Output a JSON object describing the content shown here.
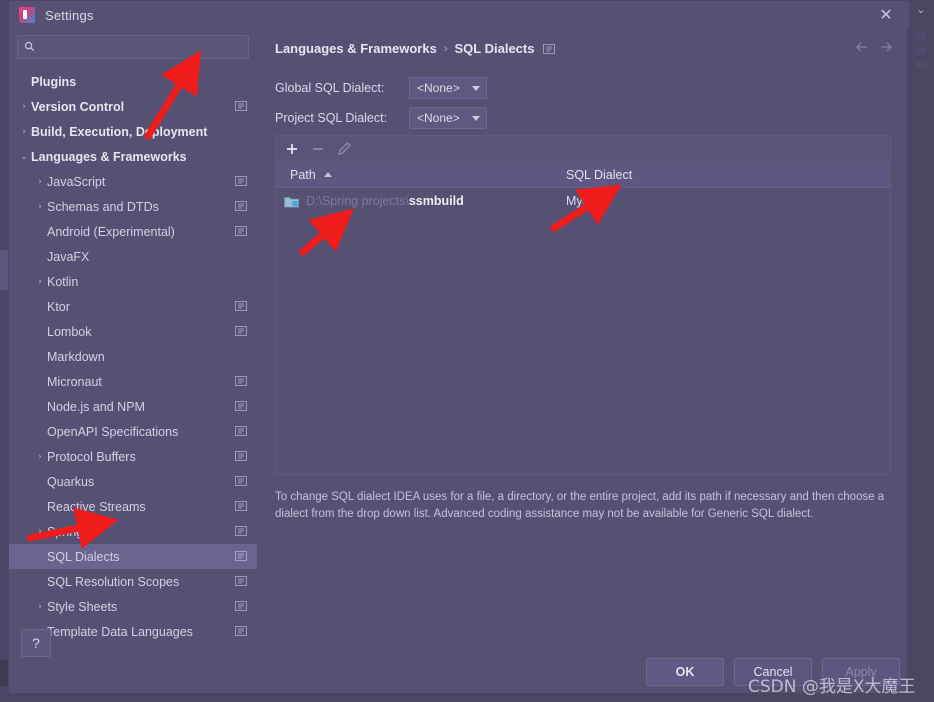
{
  "window": {
    "title": "Settings",
    "close_label": "✕",
    "app_icon": "intellij-idea-icon"
  },
  "sidebar": {
    "search": {
      "placeholder": "",
      "value": "",
      "icon": "search-icon"
    },
    "items": [
      {
        "label": "Plugins",
        "level": 1,
        "arrow": "",
        "bold": true,
        "badge": false,
        "selected": false
      },
      {
        "label": "Version Control",
        "level": 1,
        "arrow": "›",
        "bold": true,
        "badge": true,
        "selected": false
      },
      {
        "label": "Build, Execution, Deployment",
        "level": 1,
        "arrow": "›",
        "bold": true,
        "badge": false,
        "selected": false
      },
      {
        "label": "Languages & Frameworks",
        "level": 1,
        "arrow": "⌄",
        "bold": true,
        "badge": false,
        "selected": false
      },
      {
        "label": "JavaScript",
        "level": 2,
        "arrow": "›",
        "bold": false,
        "badge": true,
        "selected": false
      },
      {
        "label": "Schemas and DTDs",
        "level": 2,
        "arrow": "›",
        "bold": false,
        "badge": true,
        "selected": false
      },
      {
        "label": "Android (Experimental)",
        "level": 2,
        "arrow": "",
        "bold": false,
        "badge": true,
        "selected": false
      },
      {
        "label": "JavaFX",
        "level": 2,
        "arrow": "",
        "bold": false,
        "badge": false,
        "selected": false
      },
      {
        "label": "Kotlin",
        "level": 2,
        "arrow": "›",
        "bold": false,
        "badge": false,
        "selected": false
      },
      {
        "label": "Ktor",
        "level": 2,
        "arrow": "",
        "bold": false,
        "badge": true,
        "selected": false
      },
      {
        "label": "Lombok",
        "level": 2,
        "arrow": "",
        "bold": false,
        "badge": true,
        "selected": false
      },
      {
        "label": "Markdown",
        "level": 2,
        "arrow": "",
        "bold": false,
        "badge": false,
        "selected": false
      },
      {
        "label": "Micronaut",
        "level": 2,
        "arrow": "",
        "bold": false,
        "badge": true,
        "selected": false
      },
      {
        "label": "Node.js and NPM",
        "level": 2,
        "arrow": "",
        "bold": false,
        "badge": true,
        "selected": false
      },
      {
        "label": "OpenAPI Specifications",
        "level": 2,
        "arrow": "",
        "bold": false,
        "badge": true,
        "selected": false
      },
      {
        "label": "Protocol Buffers",
        "level": 2,
        "arrow": "›",
        "bold": false,
        "badge": true,
        "selected": false
      },
      {
        "label": "Quarkus",
        "level": 2,
        "arrow": "",
        "bold": false,
        "badge": true,
        "selected": false
      },
      {
        "label": "Reactive Streams",
        "level": 2,
        "arrow": "",
        "bold": false,
        "badge": true,
        "selected": false
      },
      {
        "label": "Spring",
        "level": 2,
        "arrow": "›",
        "bold": false,
        "badge": true,
        "selected": false
      },
      {
        "label": "SQL Dialects",
        "level": 2,
        "arrow": "",
        "bold": false,
        "badge": true,
        "selected": true
      },
      {
        "label": "SQL Resolution Scopes",
        "level": 2,
        "arrow": "",
        "bold": false,
        "badge": true,
        "selected": false
      },
      {
        "label": "Style Sheets",
        "level": 2,
        "arrow": "›",
        "bold": false,
        "badge": true,
        "selected": false
      },
      {
        "label": "Template Data Languages",
        "level": 2,
        "arrow": "",
        "bold": false,
        "badge": true,
        "selected": false
      }
    ],
    "help_label": "?"
  },
  "content": {
    "breadcrumb": {
      "parent": "Languages & Frameworks",
      "separator": "›",
      "current": "SQL Dialects"
    },
    "fields": [
      {
        "label": "Global SQL Dialect:",
        "value": "<None>"
      },
      {
        "label": "Project SQL Dialect:",
        "value": "<None>"
      }
    ],
    "toolbar": [
      {
        "name": "add-button",
        "glyph": "+",
        "disabled": false
      },
      {
        "name": "remove-button",
        "glyph": "−",
        "disabled": true
      },
      {
        "name": "edit-button",
        "glyph": "✎",
        "disabled": true
      }
    ],
    "table": {
      "columns": [
        "Path",
        "SQL Dialect"
      ],
      "sort_column": "Path",
      "sort_direction": "asc",
      "rows": [
        {
          "path_prefix": "D:\\Spring projects\\",
          "path_name": "ssmbuild",
          "dialect": "MySQL"
        }
      ]
    },
    "hint": "To change SQL dialect IDEA uses for a file, a directory, or the entire project, add its path if necessary and then choose a dialect from the drop down list. Advanced coding assistance may not be available for Generic SQL dialect."
  },
  "buttons": {
    "ok": "OK",
    "cancel": "Cancel",
    "apply": "Apply"
  },
  "watermark": "CSDN @我是X大魔王",
  "colors": {
    "window_bg": "#565073",
    "page_bg": "#4b4663",
    "selected_row": "#6a6490",
    "header_row": "#5d5781",
    "text": "#d4d1e0",
    "text_bright": "#e7e5ef",
    "text_dim": "#7d789c",
    "annotation": "#f01c1c"
  }
}
